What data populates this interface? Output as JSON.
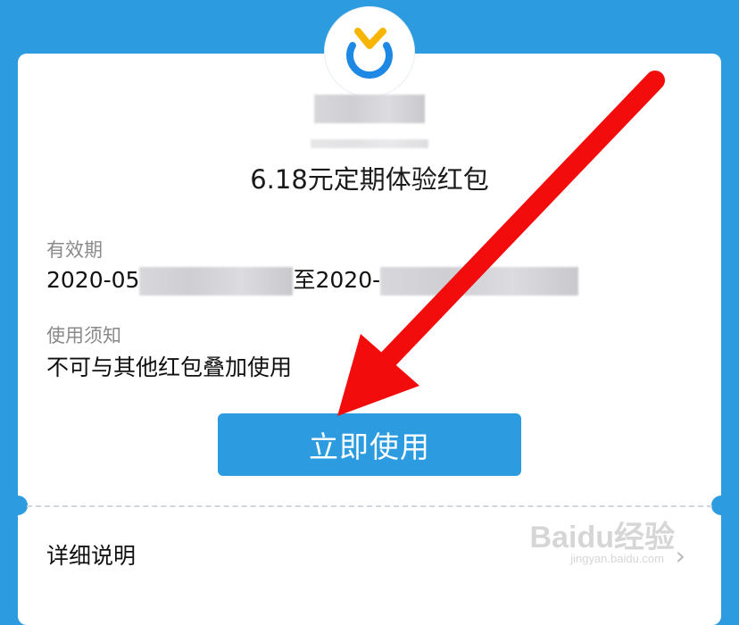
{
  "coupon": {
    "title": "6.18元定期体验红包",
    "validity_label": "有效期",
    "validity_start": "2020-05",
    "validity_sep": "至",
    "validity_end": "2020-",
    "notice_label": "使用须知",
    "notice_text": "不可与其他红包叠加使用",
    "use_button": "立即使用",
    "detail_label": "详细说明"
  },
  "watermark": {
    "brand": "Baidu经验",
    "url": "jingyan.baidu.com"
  },
  "colors": {
    "accent": "#2c9be0",
    "arrow": "#f20c0c",
    "logo_yellow": "#f7b500",
    "logo_blue": "#1e88e5"
  }
}
